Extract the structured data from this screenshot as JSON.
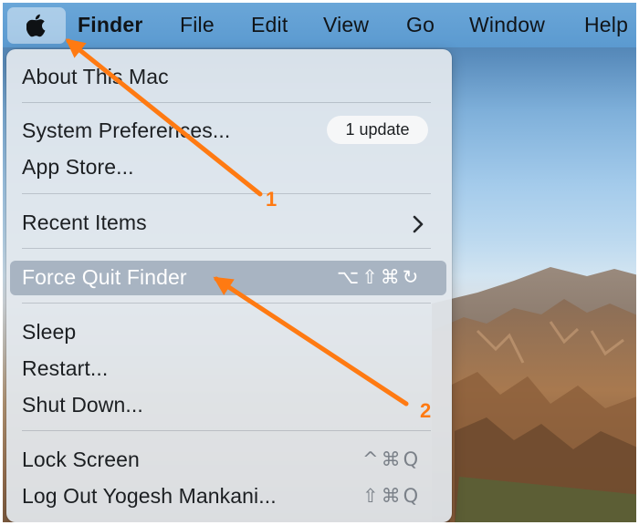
{
  "menubar": {
    "apple_icon": "apple-logo-icon",
    "items": [
      "Finder",
      "File",
      "Edit",
      "View",
      "Go",
      "Window",
      "Help"
    ]
  },
  "menu": {
    "about": "About This Mac",
    "system_prefs": "System Preferences...",
    "update_badge": "1 update",
    "app_store": "App Store...",
    "recent_items": "Recent Items",
    "force_quit": "Force Quit Finder",
    "force_quit_shortcut": "⌥⇧⌘↻",
    "sleep": "Sleep",
    "restart": "Restart...",
    "shut_down": "Shut Down...",
    "lock_screen": "Lock Screen",
    "lock_screen_shortcut": "^⌘Q",
    "log_out": "Log Out Yogesh Mankani...",
    "log_out_shortcut": "⇧⌘Q"
  },
  "annotations": {
    "callout_1": "1",
    "callout_2": "2",
    "arrow_color": "#ff7a12"
  }
}
